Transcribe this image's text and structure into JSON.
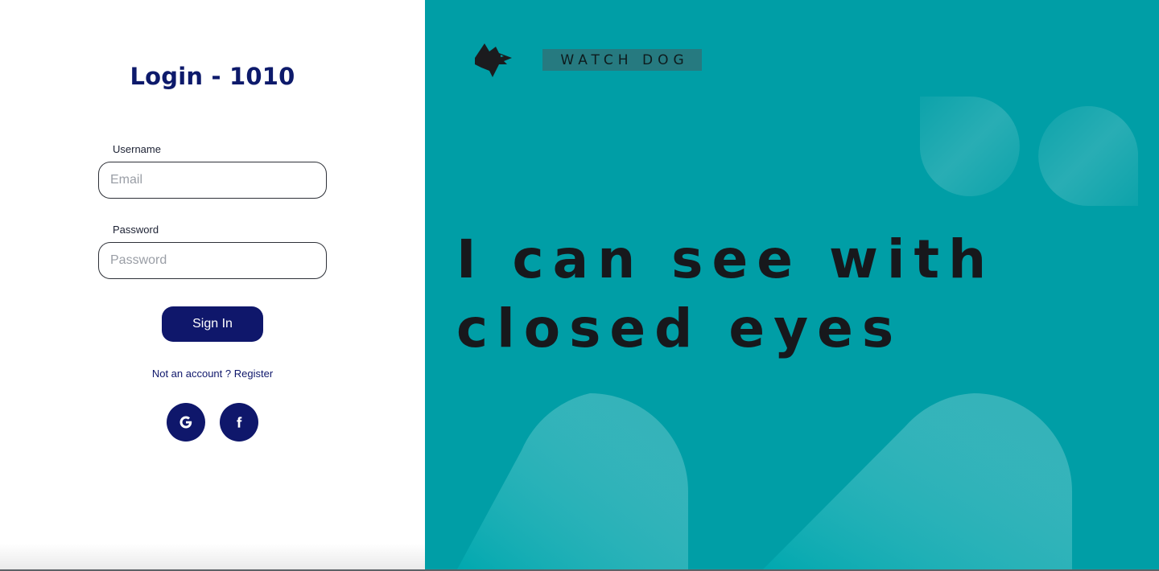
{
  "login": {
    "title": "Login - 1010",
    "username_label": "Username",
    "email_placeholder": "Email",
    "password_label": "Password",
    "password_placeholder": "Password",
    "signin_label": "Sign In",
    "register_prompt": "Not an account ?",
    "register_link": "Register",
    "social": [
      {
        "name": "google",
        "icon": "google-icon"
      },
      {
        "name": "facebook",
        "icon": "facebook-icon"
      }
    ]
  },
  "brand": {
    "name": "WATCH DOG",
    "logo_icon": "wolf-head-icon"
  },
  "hero": {
    "line1": "I can see with",
    "line2": "closed eyes"
  },
  "colors": {
    "accent": "#0f176b",
    "title": "#0d1a6b",
    "panel": "#009ea6",
    "brand_box": "#267a80",
    "headline": "#17181c"
  }
}
